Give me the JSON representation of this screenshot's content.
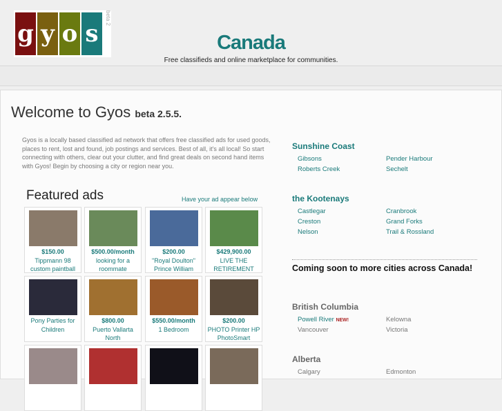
{
  "header": {
    "logo_text": "gyos",
    "logo_badge": "beta 2",
    "title": "Canada",
    "subtitle": "Free classifieds and online marketplace for communities."
  },
  "welcome": {
    "title": "Welcome to Gyos",
    "version": "beta 2.5.5.",
    "intro": "Gyos is a locally based classified ad network that offers free classified ads for used goods, places to rent, lost and found, job postings and services. Best of all, it's all local! So start connecting with others, clear out your clutter, and find great deals on second hand items with Gyos! Begin by choosing a city or region near you."
  },
  "featured": {
    "title": "Featured ads",
    "link": "Have your ad appear below",
    "ads": [
      {
        "price": "$150.00",
        "title": "Tippmann 98 custom paintball",
        "color": "#8a7a6a"
      },
      {
        "price": "$500.00/month",
        "title": "looking for a roommate",
        "color": "#6a8a5a"
      },
      {
        "price": "$200.00",
        "title": "\"Royal Doulton\" Prince William",
        "color": "#4a6a9a"
      },
      {
        "price": "$429,900.00",
        "title": "LIVE THE RETIREMENT",
        "color": "#5a8a4a"
      },
      {
        "price": "",
        "title": "Pony Parties for Children",
        "color": "#2a2a3a"
      },
      {
        "price": "$800.00",
        "title": "Puerto Vallarta North",
        "color": "#a07030"
      },
      {
        "price": "$550.00/month",
        "title": "1 Bedroom",
        "color": "#9a5a2a"
      },
      {
        "price": "$200.00",
        "title": "PHOTO Printer HP PhotoSmart",
        "color": "#5a4a3a"
      },
      {
        "price": "",
        "title": "",
        "color": "#9a8a8a"
      },
      {
        "price": "",
        "title": "",
        "color": "#b03030"
      },
      {
        "price": "",
        "title": "",
        "color": "#101018"
      },
      {
        "price": "",
        "title": "",
        "color": "#7a6a5a"
      }
    ]
  },
  "regions": [
    {
      "name": "Sunshine Coast",
      "cities": [
        "Gibsons",
        "Pender Harbour",
        "Roberts Creek",
        "Sechelt"
      ]
    },
    {
      "name": "the Kootenays",
      "cities": [
        "Castlegar",
        "Cranbrook",
        "Creston",
        "Grand Forks",
        "Nelson",
        "Trail & Rossland"
      ]
    }
  ],
  "coming_soon": "Coming soon to more cities across Canada!",
  "provinces": [
    {
      "name": "British Columbia",
      "cities": [
        "Powell River",
        "Kelowna",
        "Vancouver",
        "Victoria"
      ],
      "new_label": "NEW!"
    },
    {
      "name": "Alberta",
      "cities": [
        "Calgary",
        "Edmonton"
      ]
    }
  ]
}
